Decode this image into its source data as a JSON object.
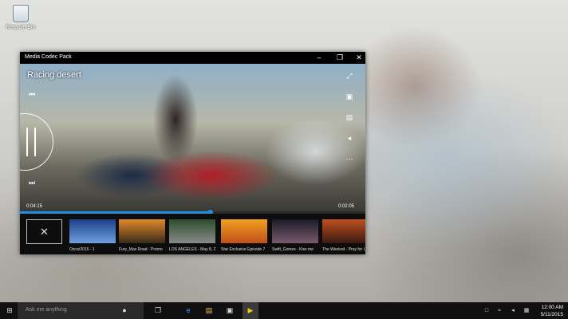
{
  "desktop": {
    "recycle_bin_label": "Recycle Bin"
  },
  "window": {
    "title": "Media Codec Pack"
  },
  "video": {
    "title": "Racing desert",
    "time_elapsed": "0:04:15",
    "time_remaining": "0:02:05",
    "progress": 0.55
  },
  "accent_color": "#1f8fe0",
  "playlist": [
    {
      "caption": "Oscar2015 - 1",
      "colors": [
        "#1e3e8a",
        "#6fa0e0"
      ]
    },
    {
      "caption": "Fury_Max Road - Promo",
      "colors": [
        "#e08a2a",
        "#3a2a1a"
      ]
    },
    {
      "caption": "LOS ANGELES - May 8, 2007",
      "colors": [
        "#2d4d2d",
        "#8a8a8a"
      ]
    },
    {
      "caption": "Star Exclusive Episode 7",
      "colors": [
        "#f2a020",
        "#c0501a"
      ]
    },
    {
      "caption": "Swift_Gomes - Kiss me",
      "colors": [
        "#1a1a2a",
        "#7a5a6a"
      ]
    },
    {
      "caption": "The Weeknd - Pray for L",
      "colors": [
        "#c05020",
        "#3a1a10"
      ]
    }
  ],
  "taskbar": {
    "search_placeholder": "Ask me anything",
    "time": "12:00 AM",
    "date": "5/11/2015"
  }
}
